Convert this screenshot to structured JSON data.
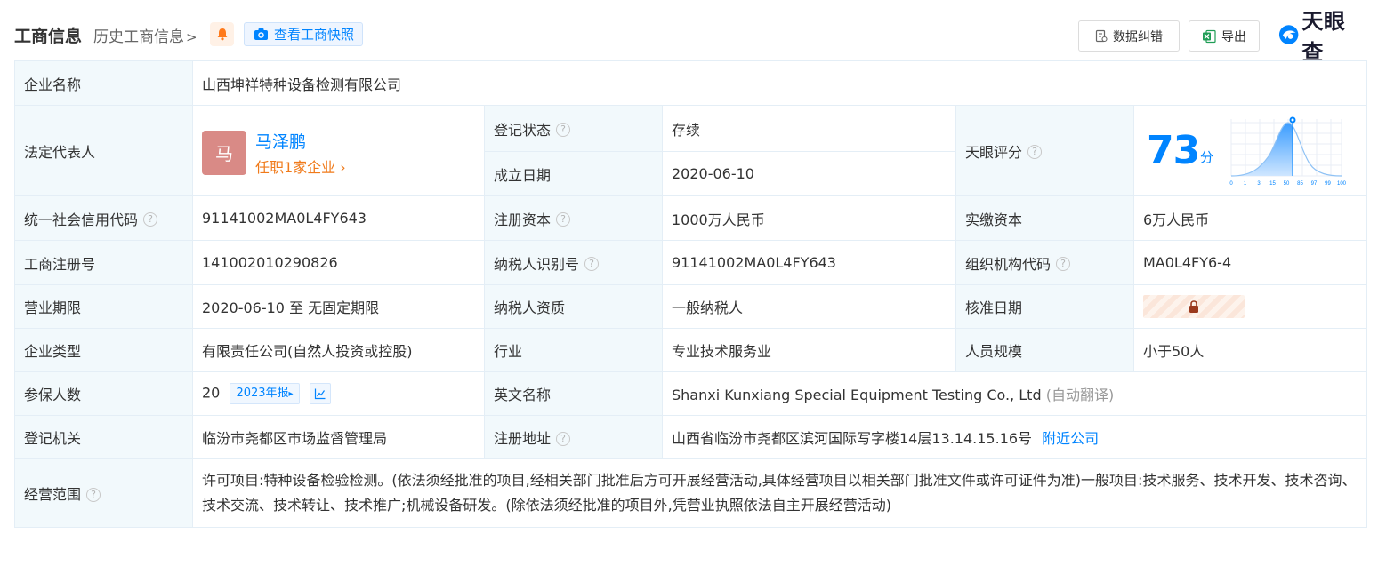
{
  "header": {
    "title": "工商信息",
    "history_link": "历史工商信息",
    "snapshot_button": "查看工商快照",
    "error_button": "数据纠错",
    "export_button": "导出",
    "logo_text": "天眼查"
  },
  "colors": {
    "brand_blue": "#0084ff",
    "status_green": "#009944",
    "link_orange": "#f07a1a",
    "label_bg": "#f2f9fc"
  },
  "company": {
    "name_label": "企业名称",
    "name": "山西坤祥特种设备检测有限公司",
    "legal_rep_label": "法定代表人",
    "legal_rep_avatar": "马",
    "legal_rep_name": "马泽鹏",
    "legal_rep_jobs": "任职1家企业",
    "reg_status_label": "登记状态",
    "reg_status": "存续",
    "found_date_label": "成立日期",
    "found_date": "2020-06-10",
    "score_label": "天眼评分",
    "score": "73",
    "score_unit": "分",
    "score_axis": [
      "0",
      "1",
      "3",
      "15",
      "50",
      "85",
      "97",
      "99",
      "100"
    ],
    "credit_code_label": "统一社会信用代码",
    "credit_code": "91141002MA0L4FY643",
    "reg_capital_label": "注册资本",
    "reg_capital": "1000万人民币",
    "paid_capital_label": "实缴资本",
    "paid_capital": "6万人民币",
    "biz_reg_no_label": "工商注册号",
    "biz_reg_no": "141002010290826",
    "taxpayer_id_label": "纳税人识别号",
    "taxpayer_id": "91141002MA0L4FY643",
    "org_code_label": "组织机构代码",
    "org_code": "MA0L4FY6-4",
    "biz_term_label": "营业期限",
    "biz_term": "2020-06-10 至 无固定期限",
    "taxpayer_qual_label": "纳税人资质",
    "taxpayer_qual": "一般纳税人",
    "approval_date_label": "核准日期",
    "company_type_label": "企业类型",
    "company_type": "有限责任公司(自然人投资或控股)",
    "industry_label": "行业",
    "industry": "专业技术服务业",
    "staff_size_label": "人员规模",
    "staff_size": "小于50人",
    "insured_label": "参保人数",
    "insured": "20",
    "insured_report": "2023年报",
    "en_name_label": "英文名称",
    "en_name": "Shanxi Kunxiang Special Equipment Testing Co., Ltd",
    "en_name_note": "(自动翻译)",
    "reg_authority_label": "登记机关",
    "reg_authority": "临汾市尧都区市场监督管理局",
    "reg_address_label": "注册地址",
    "reg_address": "山西省临汾市尧都区滨河国际写字楼14层13.14.15.16号",
    "nearby_link": "附近公司",
    "scope_label": "经营范围",
    "scope": "许可项目:特种设备检验检测。(依法须经批准的项目,经相关部门批准后方可开展经营活动,具体经营项目以相关部门批准文件或许可证件为准)一般项目:技术服务、技术开发、技术咨询、技术交流、技术转让、技术推广;机械设备研发。(除依法须经批准的项目外,凭营业执照依法自主开展经营活动)"
  }
}
